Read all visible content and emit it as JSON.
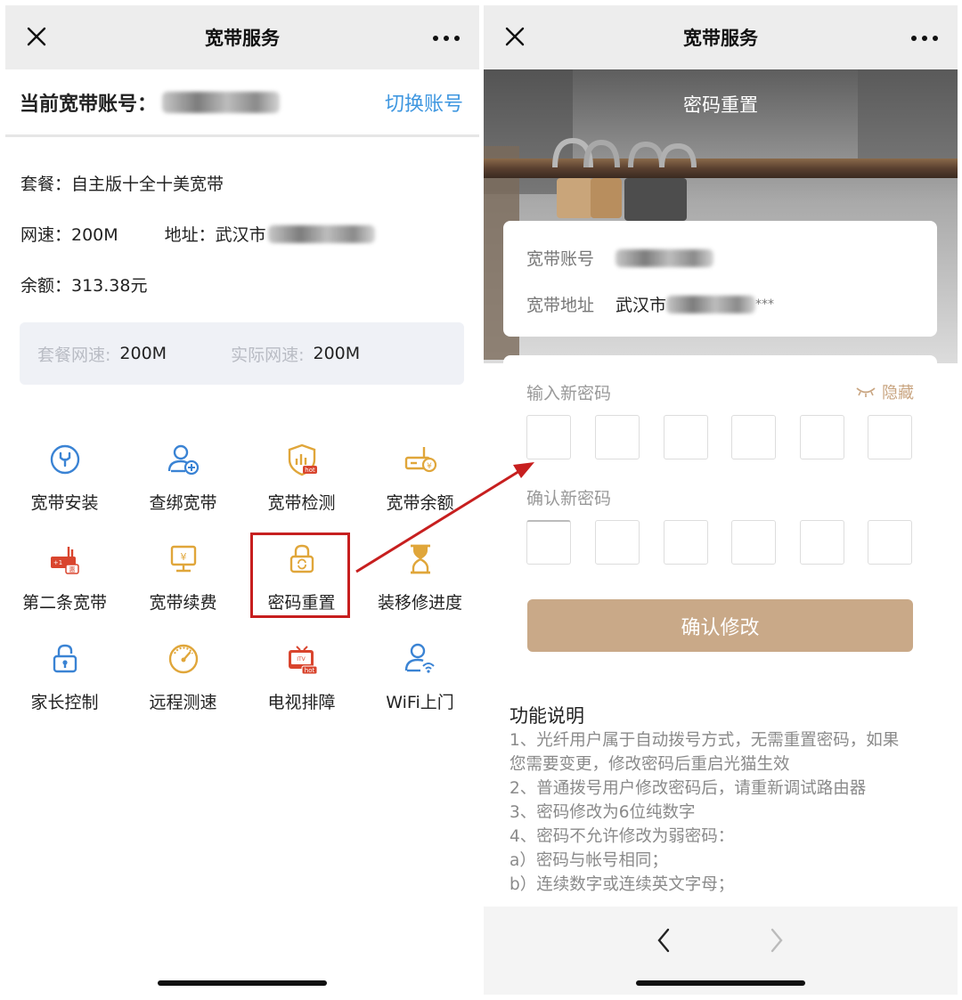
{
  "left": {
    "nav_title": "宽带服务",
    "account_label": "当前宽带账号：",
    "switch_account": "切换账号",
    "package": "套餐：自主版十全十美宽带",
    "speed": "网速：200M",
    "address_label": "地址：武汉市",
    "balance": "余额：313.38元",
    "speed_card": {
      "package_label": "套餐网速:",
      "package_value": "200M",
      "actual_label": "实际网速:",
      "actual_value": "200M"
    },
    "grid": [
      {
        "label": "宽带安装",
        "icon": "wrench-icon"
      },
      {
        "label": "查绑宽带",
        "icon": "user-add-icon"
      },
      {
        "label": "宽带检测",
        "icon": "shield-hot-icon"
      },
      {
        "label": "宽带余额",
        "icon": "router-yen-icon"
      },
      {
        "label": "第二条宽带",
        "icon": "router-plus-icon"
      },
      {
        "label": "宽带续费",
        "icon": "monitor-yen-icon"
      },
      {
        "label": "密码重置",
        "icon": "lock-refresh-icon"
      },
      {
        "label": "装移修进度",
        "icon": "hourglass-icon"
      },
      {
        "label": "家长控制",
        "icon": "lock-icon"
      },
      {
        "label": "远程测速",
        "icon": "speedometer-icon"
      },
      {
        "label": "电视排障",
        "icon": "tv-hot-icon"
      },
      {
        "label": "WiFi上门",
        "icon": "user-wifi-icon"
      }
    ],
    "badge_hot": "hot",
    "badge_hui": "惠",
    "badge_plus1": "+1",
    "tv_text": "ITV",
    "yen": "¥"
  },
  "right": {
    "nav_title": "宽带服务",
    "hero_title": "密码重置",
    "account_label": "宽带账号",
    "address_label": "宽带地址",
    "address_value": "武汉市",
    "address_suffix": "***",
    "new_pw_label": "输入新密码",
    "hide_label": "隐藏",
    "confirm_pw_label": "确认新密码",
    "confirm_button": "确认修改",
    "func_title": "功能说明",
    "func_lines": [
      "1、光纤用户属于自动拨号方式，无需重置密码，如果",
      "您需要变更，修改密码后重启光猫生效",
      "2、普通拨号用户修改密码后，请重新调试路由器",
      "3、密码修改为6位纯数字",
      "4、密码不允许修改为弱密码：",
      "a）密码与帐号相同；",
      "b）连续数字或连续英文字母；"
    ]
  },
  "colors": {
    "accent_blue": "#3f97e0",
    "icon_blue": "#3a83d4",
    "icon_gold": "#e0a63a",
    "icon_red": "#d9452e",
    "highlight_red": "#c71f1f",
    "button_tan": "#c9a988"
  }
}
